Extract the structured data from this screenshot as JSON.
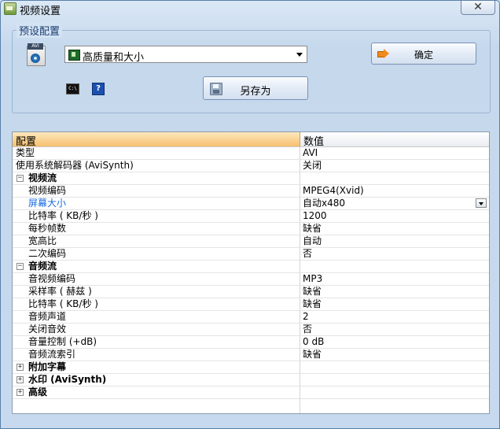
{
  "window": {
    "title": "视频设置",
    "close_label": "✕"
  },
  "preset": {
    "group_title": "预设配置",
    "selected": "高质量和大小",
    "ok_label": "确定",
    "save_as_label": "另存为",
    "cmd_icon_text": "C:\\",
    "help_icon_text": "?"
  },
  "grid": {
    "header": {
      "name": "配置",
      "value": "数值"
    },
    "rows": [
      {
        "name": "类型",
        "value": "AVI",
        "level": 0
      },
      {
        "name": "使用系统解码器 (AviSynth)",
        "value": "关闭",
        "level": 0
      },
      {
        "name": "视频流",
        "value": "",
        "level": "group",
        "expanded": true
      },
      {
        "name": "视频编码",
        "value": "MPEG4(Xvid)",
        "level": 1
      },
      {
        "name": "屏幕大小",
        "value": "自动x480",
        "level": 1,
        "selected": true
      },
      {
        "name": "比特率 ( KB/秒 )",
        "value": "1200",
        "level": 1
      },
      {
        "name": "每秒帧数",
        "value": "缺省",
        "level": 1
      },
      {
        "name": "宽高比",
        "value": "自动",
        "level": 1
      },
      {
        "name": "二次编码",
        "value": "否",
        "level": 1
      },
      {
        "name": "音频流",
        "value": "",
        "level": "group",
        "expanded": true
      },
      {
        "name": "音视频编码",
        "value": "MP3",
        "level": 1
      },
      {
        "name": "采样率 ( 赫兹 )",
        "value": "缺省",
        "level": 1
      },
      {
        "name": "比特率 ( KB/秒 )",
        "value": "缺省",
        "level": 1
      },
      {
        "name": "音频声道",
        "value": "2",
        "level": 1
      },
      {
        "name": "关闭音效",
        "value": "否",
        "level": 1
      },
      {
        "name": "音量控制 (+dB)",
        "value": "0 dB",
        "level": 1
      },
      {
        "name": "音频流索引",
        "value": "缺省",
        "level": 1
      },
      {
        "name": "附加字幕",
        "value": "",
        "level": "group",
        "expanded": false
      },
      {
        "name": "水印 (AviSynth)",
        "value": "",
        "level": "group",
        "expanded": false
      },
      {
        "name": "高级",
        "value": "",
        "level": "group",
        "expanded": false
      }
    ]
  }
}
